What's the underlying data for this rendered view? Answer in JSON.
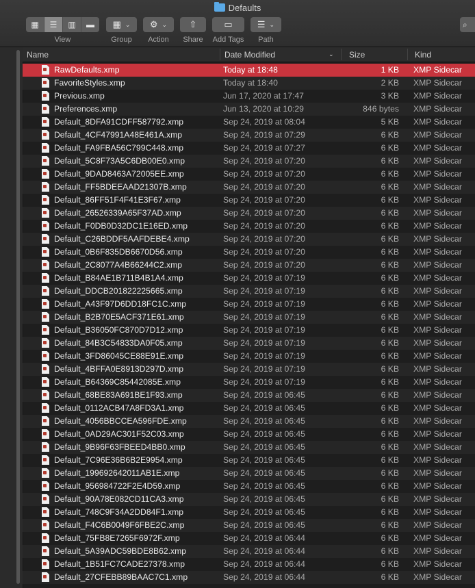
{
  "window": {
    "title": "Defaults"
  },
  "toolbar": {
    "view_label": "View",
    "group_label": "Group",
    "action_label": "Action",
    "share_label": "Share",
    "add_tags_label": "Add Tags",
    "path_label": "Path"
  },
  "columns": {
    "name": "Name",
    "date": "Date Modified",
    "size": "Size",
    "kind": "Kind"
  },
  "files": [
    {
      "name": "RawDefaults.xmp",
      "date": "Today at 18:48",
      "size": "1 KB",
      "kind": "XMP Sidecar"
    },
    {
      "name": "FavoriteStyles.xmp",
      "date": "Today at 18:40",
      "size": "2 KB",
      "kind": "XMP Sidecar"
    },
    {
      "name": "Previous.xmp",
      "date": "Jun 17, 2020 at 17:47",
      "size": "3 KB",
      "kind": "XMP Sidecar"
    },
    {
      "name": "Preferences.xmp",
      "date": "Jun 13, 2020 at 10:29",
      "size": "846 bytes",
      "kind": "XMP Sidecar"
    },
    {
      "name": "Default_8DFA91CDFF587792.xmp",
      "date": "Sep 24, 2019 at 08:04",
      "size": "5 KB",
      "kind": "XMP Sidecar"
    },
    {
      "name": "Default_4CF47991A48E461A.xmp",
      "date": "Sep 24, 2019 at 07:29",
      "size": "6 KB",
      "kind": "XMP Sidecar"
    },
    {
      "name": "Default_FA9FBA56C799C448.xmp",
      "date": "Sep 24, 2019 at 07:27",
      "size": "6 KB",
      "kind": "XMP Sidecar"
    },
    {
      "name": "Default_5C8F73A5C6DB00E0.xmp",
      "date": "Sep 24, 2019 at 07:20",
      "size": "6 KB",
      "kind": "XMP Sidecar"
    },
    {
      "name": "Default_9DAD8463A72005EE.xmp",
      "date": "Sep 24, 2019 at 07:20",
      "size": "6 KB",
      "kind": "XMP Sidecar"
    },
    {
      "name": "Default_FF5BDEEAAD21307B.xmp",
      "date": "Sep 24, 2019 at 07:20",
      "size": "6 KB",
      "kind": "XMP Sidecar"
    },
    {
      "name": "Default_86FF51F4F41E3F67.xmp",
      "date": "Sep 24, 2019 at 07:20",
      "size": "6 KB",
      "kind": "XMP Sidecar"
    },
    {
      "name": "Default_26526339A65F37AD.xmp",
      "date": "Sep 24, 2019 at 07:20",
      "size": "6 KB",
      "kind": "XMP Sidecar"
    },
    {
      "name": "Default_F0DB0D32DC1E16ED.xmp",
      "date": "Sep 24, 2019 at 07:20",
      "size": "6 KB",
      "kind": "XMP Sidecar"
    },
    {
      "name": "Default_C26BDDF5AAFDEBE4.xmp",
      "date": "Sep 24, 2019 at 07:20",
      "size": "6 KB",
      "kind": "XMP Sidecar"
    },
    {
      "name": "Default_0B6F835DB6670D56.xmp",
      "date": "Sep 24, 2019 at 07:20",
      "size": "6 KB",
      "kind": "XMP Sidecar"
    },
    {
      "name": "Default_2C8077A4B66244C2.xmp",
      "date": "Sep 24, 2019 at 07:20",
      "size": "6 KB",
      "kind": "XMP Sidecar"
    },
    {
      "name": "Default_B84AE1B711B4B1A4.xmp",
      "date": "Sep 24, 2019 at 07:19",
      "size": "6 KB",
      "kind": "XMP Sidecar"
    },
    {
      "name": "Default_DDCB201822225665.xmp",
      "date": "Sep 24, 2019 at 07:19",
      "size": "6 KB",
      "kind": "XMP Sidecar"
    },
    {
      "name": "Default_A43F97D6DD18FC1C.xmp",
      "date": "Sep 24, 2019 at 07:19",
      "size": "6 KB",
      "kind": "XMP Sidecar"
    },
    {
      "name": "Default_B2B70E5ACF371E61.xmp",
      "date": "Sep 24, 2019 at 07:19",
      "size": "6 KB",
      "kind": "XMP Sidecar"
    },
    {
      "name": "Default_B36050FC870D7D12.xmp",
      "date": "Sep 24, 2019 at 07:19",
      "size": "6 KB",
      "kind": "XMP Sidecar"
    },
    {
      "name": "Default_84B3C54833DA0F05.xmp",
      "date": "Sep 24, 2019 at 07:19",
      "size": "6 KB",
      "kind": "XMP Sidecar"
    },
    {
      "name": "Default_3FD86045CE88E91E.xmp",
      "date": "Sep 24, 2019 at 07:19",
      "size": "6 KB",
      "kind": "XMP Sidecar"
    },
    {
      "name": "Default_4BFFA0E8913D297D.xmp",
      "date": "Sep 24, 2019 at 07:19",
      "size": "6 KB",
      "kind": "XMP Sidecar"
    },
    {
      "name": "Default_B64369C85442085E.xmp",
      "date": "Sep 24, 2019 at 07:19",
      "size": "6 KB",
      "kind": "XMP Sidecar"
    },
    {
      "name": "Default_68BE83A691BE1F93.xmp",
      "date": "Sep 24, 2019 at 06:45",
      "size": "6 KB",
      "kind": "XMP Sidecar"
    },
    {
      "name": "Default_0112ACB47A8FD3A1.xmp",
      "date": "Sep 24, 2019 at 06:45",
      "size": "6 KB",
      "kind": "XMP Sidecar"
    },
    {
      "name": "Default_4056BBCCEA596FDE.xmp",
      "date": "Sep 24, 2019 at 06:45",
      "size": "6 KB",
      "kind": "XMP Sidecar"
    },
    {
      "name": "Default_0AD29AC301F52C03.xmp",
      "date": "Sep 24, 2019 at 06:45",
      "size": "6 KB",
      "kind": "XMP Sidecar"
    },
    {
      "name": "Default_9B96F63FBEED4BB0.xmp",
      "date": "Sep 24, 2019 at 06:45",
      "size": "6 KB",
      "kind": "XMP Sidecar"
    },
    {
      "name": "Default_7C96E36B6B2E9954.xmp",
      "date": "Sep 24, 2019 at 06:45",
      "size": "6 KB",
      "kind": "XMP Sidecar"
    },
    {
      "name": "Default_199692642011AB1E.xmp",
      "date": "Sep 24, 2019 at 06:45",
      "size": "6 KB",
      "kind": "XMP Sidecar"
    },
    {
      "name": "Default_956984722F2E4D59.xmp",
      "date": "Sep 24, 2019 at 06:45",
      "size": "6 KB",
      "kind": "XMP Sidecar"
    },
    {
      "name": "Default_90A78E082CD11CA3.xmp",
      "date": "Sep 24, 2019 at 06:45",
      "size": "6 KB",
      "kind": "XMP Sidecar"
    },
    {
      "name": "Default_748C9F34A2DD84F1.xmp",
      "date": "Sep 24, 2019 at 06:45",
      "size": "6 KB",
      "kind": "XMP Sidecar"
    },
    {
      "name": "Default_F4C6B0049F6FBE2C.xmp",
      "date": "Sep 24, 2019 at 06:45",
      "size": "6 KB",
      "kind": "XMP Sidecar"
    },
    {
      "name": "Default_75FB8E7265F6972F.xmp",
      "date": "Sep 24, 2019 at 06:44",
      "size": "6 KB",
      "kind": "XMP Sidecar"
    },
    {
      "name": "Default_5A39ADC59BDE8B62.xmp",
      "date": "Sep 24, 2019 at 06:44",
      "size": "6 KB",
      "kind": "XMP Sidecar"
    },
    {
      "name": "Default_1B51FC7CADE27378.xmp",
      "date": "Sep 24, 2019 at 06:44",
      "size": "6 KB",
      "kind": "XMP Sidecar"
    },
    {
      "name": "Default_27CFEBB89BAAC7C1.xmp",
      "date": "Sep 24, 2019 at 06:44",
      "size": "6 KB",
      "kind": "XMP Sidecar"
    }
  ],
  "colors": {
    "selection": "#c8343d",
    "background": "#1e1e1e",
    "toolbar": "#383838"
  }
}
